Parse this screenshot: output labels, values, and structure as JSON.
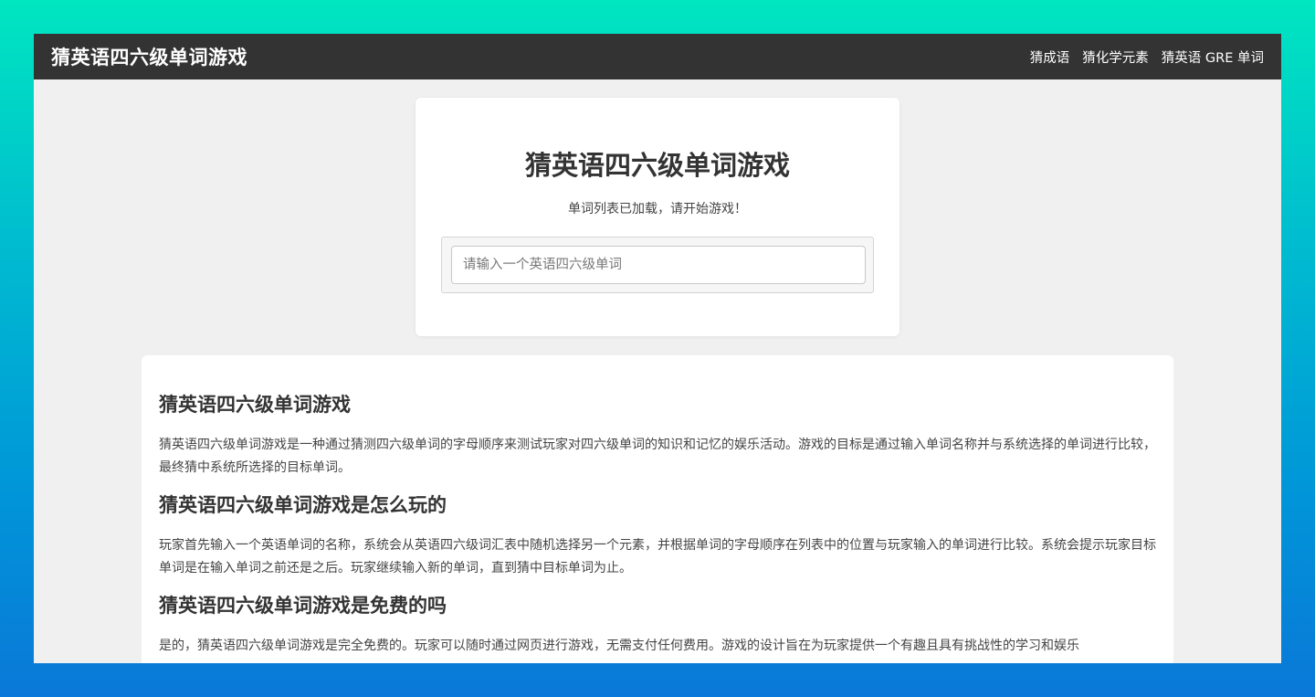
{
  "navbar": {
    "brand": "猜英语四六级单词游戏",
    "links": [
      "猜成语",
      "猜化学元素",
      "猜英语 GRE 单词"
    ]
  },
  "game": {
    "title": "猜英语四六级单词游戏",
    "status": "单词列表已加载，请开始游戏！",
    "input_placeholder": "请输入一个英语四六级单词"
  },
  "info": {
    "sections": [
      {
        "heading": "猜英语四六级单词游戏",
        "text": "猜英语四六级单词游戏是一种通过猜测四六级单词的字母顺序来测试玩家对四六级单词的知识和记忆的娱乐活动。游戏的目标是通过输入单词名称并与系统选择的单词进行比较，最终猜中系统所选择的目标单词。"
      },
      {
        "heading": "猜英语四六级单词游戏是怎么玩的",
        "text": "玩家首先输入一个英语单词的名称，系统会从英语四六级词汇表中随机选择另一个元素，并根据单词的字母顺序在列表中的位置与玩家输入的单词进行比较。系统会提示玩家目标单词是在输入单词之前还是之后。玩家继续输入新的单词，直到猜中目标单词为止。"
      },
      {
        "heading": "猜英语四六级单词游戏是免费的吗",
        "text": "是的，猜英语四六级单词游戏是完全免费的。玩家可以随时通过网页进行游戏，无需支付任何费用。游戏的设计旨在为玩家提供一个有趣且具有挑战性的学习和娱乐"
      }
    ]
  }
}
